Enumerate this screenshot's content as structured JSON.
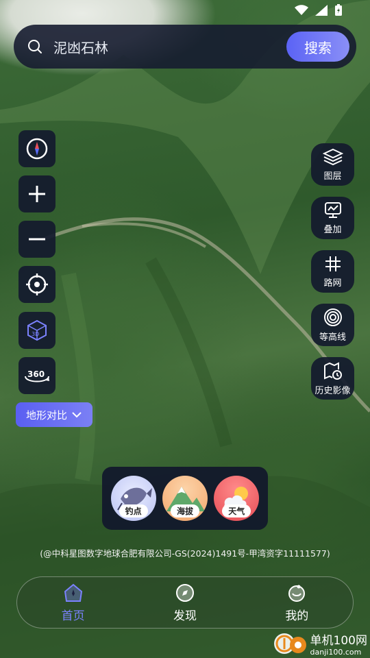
{
  "search": {
    "query": "泥凼石林",
    "button_label": "搜索"
  },
  "left_controls": {
    "terrain_compare_label": "地形对比"
  },
  "right_tools": [
    {
      "label": "图层"
    },
    {
      "label": "叠加"
    },
    {
      "label": "路网"
    },
    {
      "label": "等高线"
    },
    {
      "label": "历史影像"
    }
  ],
  "quick_actions": [
    {
      "label": "钓点"
    },
    {
      "label": "海拔"
    },
    {
      "label": "天气"
    }
  ],
  "copyright": "(@中科星图数字地球合肥有限公司-GS(2024)1491号-甲湾资字11111577)",
  "nav": {
    "items": [
      {
        "label": "首页"
      },
      {
        "label": "发现"
      },
      {
        "label": "我的"
      }
    ]
  },
  "watermark": {
    "title": "单机100网",
    "url": "danji100.com"
  },
  "colors": {
    "accent": "#6a70f5",
    "panel": "#141a2e"
  }
}
